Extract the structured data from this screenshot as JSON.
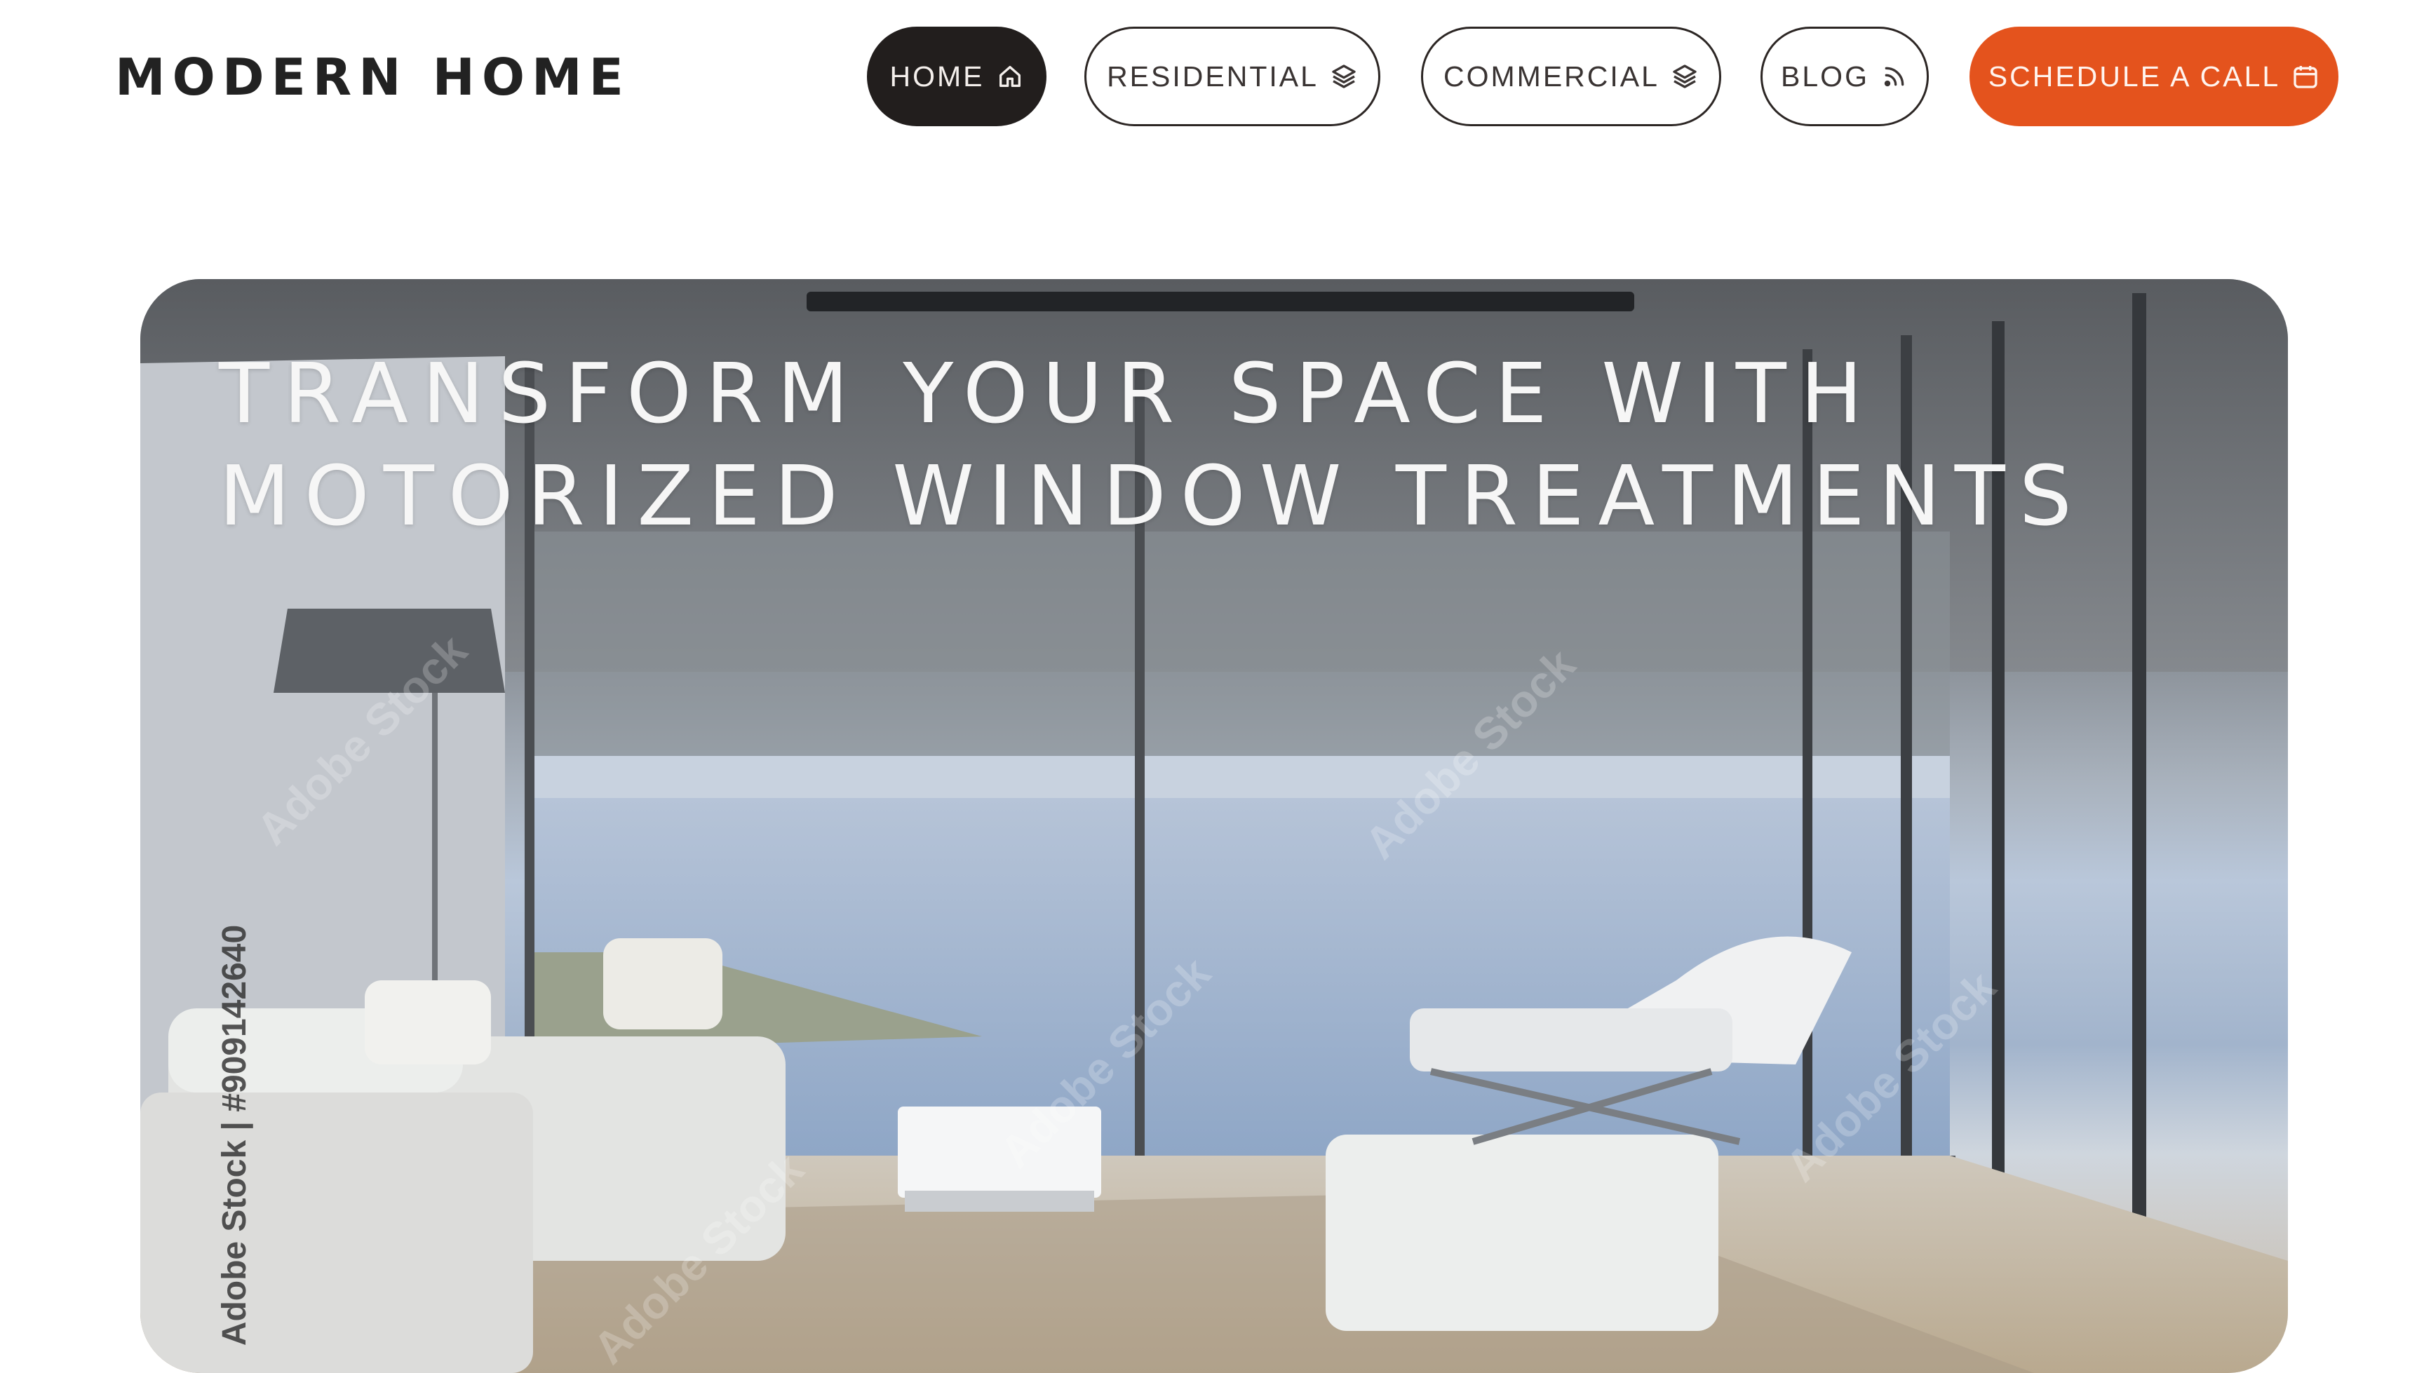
{
  "brand": {
    "name": "MODERN HOME"
  },
  "nav": {
    "items": [
      {
        "label": "HOME",
        "icon": "home-icon",
        "state": "active"
      },
      {
        "label": "RESIDENTIAL",
        "icon": "layers-icon",
        "state": "default"
      },
      {
        "label": "COMMERCIAL",
        "icon": "layers-icon",
        "state": "default"
      },
      {
        "label": "BLOG",
        "icon": "rss-icon",
        "state": "default"
      }
    ],
    "cta": {
      "label": "SCHEDULE A CALL",
      "icon": "calendar-icon"
    }
  },
  "hero": {
    "headline_line1": "TRANSFORM YOUR SPACE WITH",
    "headline_line2": "MOTORIZED WINDOW TREATMENTS",
    "watermark": "Adobe Stock",
    "stock_id": "Adobe Stock | #909142640"
  },
  "colors": {
    "accent": "#e4531d",
    "active_nav": "#221e1d",
    "text_dark": "#222222"
  }
}
